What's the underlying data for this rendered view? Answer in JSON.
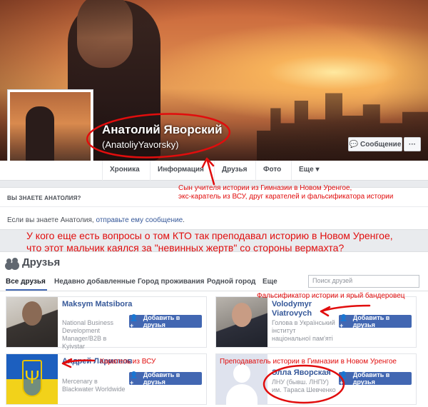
{
  "profile": {
    "name": "Анатолий Яворский",
    "username": "(AnatoliyYavorsky)",
    "message_button": "Сообщение",
    "more_button": "···"
  },
  "tabs": [
    "Хроника",
    "Информация",
    "Друзья",
    "Фото",
    "Еще ▾"
  ],
  "know_box": {
    "title": "ВЫ ЗНАЕТЕ АНАТОЛИЯ?",
    "text_prefix": "Если вы знаете Анатолия, ",
    "link": "отправьте ему сообщение",
    "text_suffix": "."
  },
  "annotations": {
    "caption_right": [
      "Сын учителя истории из Гимназии в Новом Уренгое,",
      "экс-каратель из ВСУ, друг карателей и фальсификатора истории"
    ],
    "caption_big": [
      "У кого еще есть вопросы о том КТО так преподавал историю в Новом Уренгое,",
      "что этот мальчик каялся за \"невинных жертв\" со стороны вермахта?"
    ],
    "falsifier": "Фальсификатор истории и ярый бандеровец",
    "punisher": "Каратель из ВСУ",
    "teacher": "Преподаватель истории в Гимназии в Новом Уренгое"
  },
  "friends": {
    "title": "Друзья",
    "tabs": [
      "Все друзья",
      "Недавно добавленные",
      "Город проживания",
      "Родной город",
      "Еще"
    ],
    "search_placeholder": "Поиск друзей",
    "add_button_label": "Добавить в друзья",
    "cards": [
      {
        "name": "Maksym Matsibora",
        "desc": [
          "National Business",
          "Development",
          "Manager/B2B в",
          "Kyivstar"
        ]
      },
      {
        "name": "Volodymyr Viatrovych",
        "desc": [
          "Голова в Український",
          "інститут",
          "національної пам'яті"
        ]
      },
      {
        "name": "Андрей Ларионов",
        "desc": [
          "Mercenary в",
          "Blackwater Worldwide"
        ]
      },
      {
        "name": "Элла Яворская",
        "desc": [
          "ЛНУ (бывш. ЛНПУ)",
          "им. Тараса Шевченко"
        ]
      }
    ]
  },
  "colors": {
    "annotation_red": "#e10d0d",
    "facebook_blue": "#4267b2",
    "link_blue": "#365899"
  }
}
